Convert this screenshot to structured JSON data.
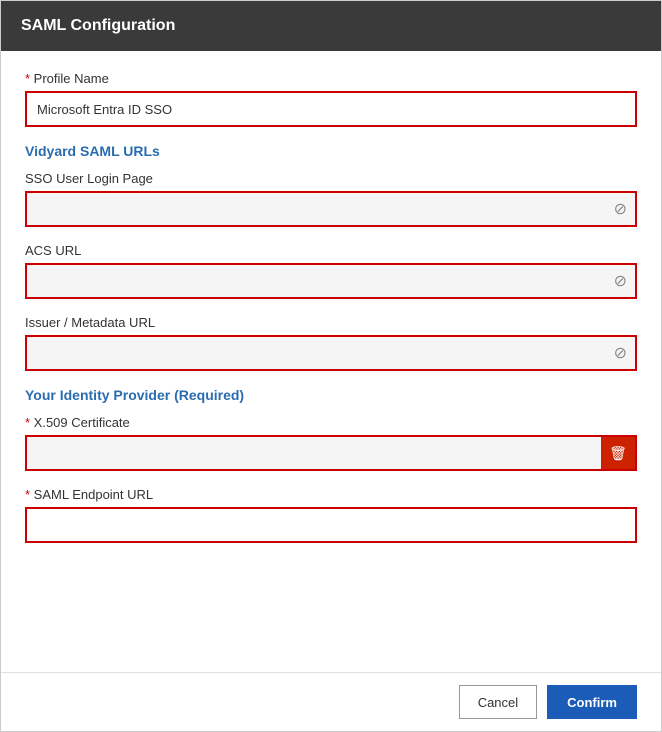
{
  "modal": {
    "title": "SAML Configuration"
  },
  "form": {
    "profile_name_label": "Profile Name",
    "profile_name_value": "Microsoft Entra ID SSO",
    "vidyard_saml_urls_title": "Vidyard SAML URLs",
    "sso_user_login_page_label": "SSO User Login Page",
    "sso_user_login_page_value": "",
    "acs_url_label": "ACS URL",
    "acs_url_value": "",
    "issuer_metadata_url_label": "Issuer / Metadata URL",
    "issuer_metadata_url_value": "",
    "identity_provider_title": "Your Identity Provider (Required)",
    "x509_cert_label": "X.509 Certificate",
    "x509_cert_value": "",
    "saml_endpoint_url_label": "SAML Endpoint URL",
    "saml_endpoint_url_value": ""
  },
  "footer": {
    "cancel_label": "Cancel",
    "confirm_label": "Confirm"
  },
  "icons": {
    "no_copy": "⊘",
    "trash": "🗑"
  }
}
